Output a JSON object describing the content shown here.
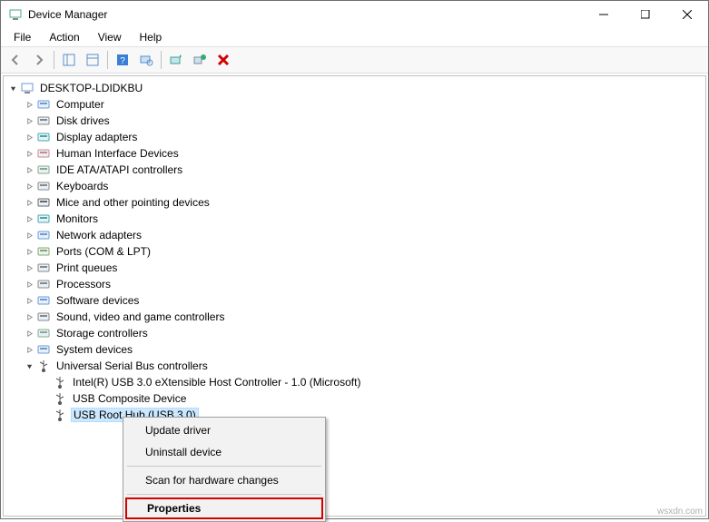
{
  "window": {
    "title": "Device Manager"
  },
  "menu": {
    "file": "File",
    "action": "Action",
    "view": "View",
    "help": "Help"
  },
  "tree": {
    "root": "DESKTOP-LDIDKBU",
    "categories": [
      {
        "label": "Computer",
        "icon": "computer"
      },
      {
        "label": "Disk drives",
        "icon": "disk"
      },
      {
        "label": "Display adapters",
        "icon": "display"
      },
      {
        "label": "Human Interface Devices",
        "icon": "hid"
      },
      {
        "label": "IDE ATA/ATAPI controllers",
        "icon": "ide"
      },
      {
        "label": "Keyboards",
        "icon": "keyboard"
      },
      {
        "label": "Mice and other pointing devices",
        "icon": "mouse"
      },
      {
        "label": "Monitors",
        "icon": "monitor"
      },
      {
        "label": "Network adapters",
        "icon": "network"
      },
      {
        "label": "Ports (COM & LPT)",
        "icon": "ports"
      },
      {
        "label": "Print queues",
        "icon": "printer"
      },
      {
        "label": "Processors",
        "icon": "cpu"
      },
      {
        "label": "Software devices",
        "icon": "software"
      },
      {
        "label": "Sound, video and game controllers",
        "icon": "sound"
      },
      {
        "label": "Storage controllers",
        "icon": "storage"
      },
      {
        "label": "System devices",
        "icon": "system"
      }
    ],
    "usb_cat": "Universal Serial Bus controllers",
    "usb_children": [
      "Intel(R) USB 3.0 eXtensible Host Controller - 1.0 (Microsoft)",
      "USB Composite Device",
      "USB Root Hub (USB 3.0)"
    ]
  },
  "context_menu": {
    "update": "Update driver",
    "uninstall": "Uninstall device",
    "scan": "Scan for hardware changes",
    "properties": "Properties"
  },
  "watermark": "wsxdn.com"
}
